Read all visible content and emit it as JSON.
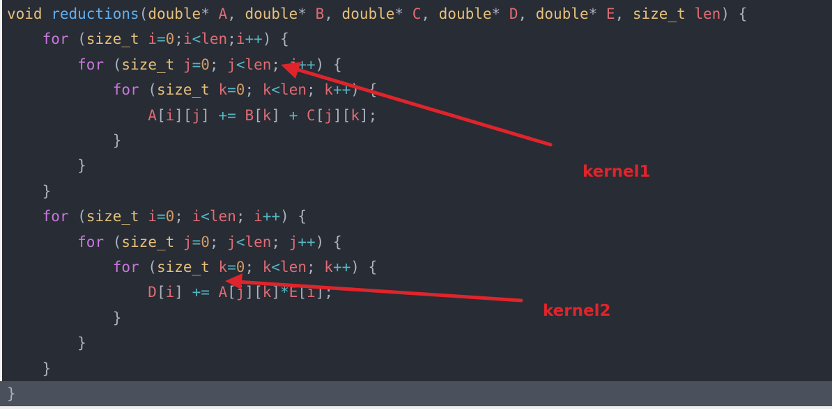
{
  "editor": {
    "lines": [
      [
        [
          "ty",
          "void"
        ],
        [
          "pun",
          " "
        ],
        [
          "fn",
          "reductions"
        ],
        [
          "pun",
          "("
        ],
        [
          "ty",
          "double"
        ],
        [
          "pun",
          "* "
        ],
        [
          "var",
          "A"
        ],
        [
          "pun",
          ", "
        ],
        [
          "ty",
          "double"
        ],
        [
          "pun",
          "* "
        ],
        [
          "var",
          "B"
        ],
        [
          "pun",
          ", "
        ],
        [
          "ty",
          "double"
        ],
        [
          "pun",
          "* "
        ],
        [
          "var",
          "C"
        ],
        [
          "pun",
          ", "
        ],
        [
          "ty",
          "double"
        ],
        [
          "pun",
          "* "
        ],
        [
          "var",
          "D"
        ],
        [
          "pun",
          ", "
        ],
        [
          "ty",
          "double"
        ],
        [
          "pun",
          "* "
        ],
        [
          "var",
          "E"
        ],
        [
          "pun",
          ", "
        ],
        [
          "ty",
          "size_t"
        ],
        [
          "pun",
          " "
        ],
        [
          "var",
          "len"
        ],
        [
          "pun",
          ") {"
        ]
      ],
      [
        [
          "pun",
          "    "
        ],
        [
          "kw",
          "for"
        ],
        [
          "pun",
          " ("
        ],
        [
          "ty",
          "size_t"
        ],
        [
          "pun",
          " "
        ],
        [
          "var",
          "i"
        ],
        [
          "op",
          "="
        ],
        [
          "num",
          "0"
        ],
        [
          "pun",
          ";"
        ],
        [
          "var",
          "i"
        ],
        [
          "op",
          "<"
        ],
        [
          "var",
          "len"
        ],
        [
          "pun",
          ";"
        ],
        [
          "var",
          "i"
        ],
        [
          "op",
          "++"
        ],
        [
          "pun",
          ") {"
        ]
      ],
      [
        [
          "pun",
          "        "
        ],
        [
          "kw",
          "for"
        ],
        [
          "pun",
          " ("
        ],
        [
          "ty",
          "size_t"
        ],
        [
          "pun",
          " "
        ],
        [
          "var",
          "j"
        ],
        [
          "op",
          "="
        ],
        [
          "num",
          "0"
        ],
        [
          "pun",
          "; "
        ],
        [
          "var",
          "j"
        ],
        [
          "op",
          "<"
        ],
        [
          "var",
          "len"
        ],
        [
          "pun",
          "; "
        ],
        [
          "var",
          "j"
        ],
        [
          "op",
          "++"
        ],
        [
          "pun",
          ") {"
        ]
      ],
      [
        [
          "pun",
          "            "
        ],
        [
          "kw",
          "for"
        ],
        [
          "pun",
          " ("
        ],
        [
          "ty",
          "size_t"
        ],
        [
          "pun",
          " "
        ],
        [
          "var",
          "k"
        ],
        [
          "op",
          "="
        ],
        [
          "num",
          "0"
        ],
        [
          "pun",
          "; "
        ],
        [
          "var",
          "k"
        ],
        [
          "op",
          "<"
        ],
        [
          "var",
          "len"
        ],
        [
          "pun",
          "; "
        ],
        [
          "var",
          "k"
        ],
        [
          "op",
          "++"
        ],
        [
          "pun",
          ") {"
        ]
      ],
      [
        [
          "pun",
          "                "
        ],
        [
          "var",
          "A"
        ],
        [
          "pun",
          "["
        ],
        [
          "var",
          "i"
        ],
        [
          "pun",
          "]["
        ],
        [
          "var",
          "j"
        ],
        [
          "pun",
          "] "
        ],
        [
          "op",
          "+="
        ],
        [
          "pun",
          " "
        ],
        [
          "var",
          "B"
        ],
        [
          "pun",
          "["
        ],
        [
          "var",
          "k"
        ],
        [
          "pun",
          "] "
        ],
        [
          "op",
          "+"
        ],
        [
          "pun",
          " "
        ],
        [
          "var",
          "C"
        ],
        [
          "pun",
          "["
        ],
        [
          "var",
          "j"
        ],
        [
          "pun",
          "]["
        ],
        [
          "var",
          "k"
        ],
        [
          "pun",
          "];"
        ]
      ],
      [
        [
          "pun",
          "            }"
        ]
      ],
      [
        [
          "pun",
          "        }"
        ]
      ],
      [
        [
          "pun",
          "    }"
        ]
      ],
      [
        [
          "pun",
          "    "
        ],
        [
          "kw",
          "for"
        ],
        [
          "pun",
          " ("
        ],
        [
          "ty",
          "size_t"
        ],
        [
          "pun",
          " "
        ],
        [
          "var",
          "i"
        ],
        [
          "op",
          "="
        ],
        [
          "num",
          "0"
        ],
        [
          "pun",
          "; "
        ],
        [
          "var",
          "i"
        ],
        [
          "op",
          "<"
        ],
        [
          "var",
          "len"
        ],
        [
          "pun",
          "; "
        ],
        [
          "var",
          "i"
        ],
        [
          "op",
          "++"
        ],
        [
          "pun",
          ") {"
        ]
      ],
      [
        [
          "pun",
          "        "
        ],
        [
          "kw",
          "for"
        ],
        [
          "pun",
          " ("
        ],
        [
          "ty",
          "size_t"
        ],
        [
          "pun",
          " "
        ],
        [
          "var",
          "j"
        ],
        [
          "op",
          "="
        ],
        [
          "num",
          "0"
        ],
        [
          "pun",
          "; "
        ],
        [
          "var",
          "j"
        ],
        [
          "op",
          "<"
        ],
        [
          "var",
          "len"
        ],
        [
          "pun",
          "; "
        ],
        [
          "var",
          "j"
        ],
        [
          "op",
          "++"
        ],
        [
          "pun",
          ") {"
        ]
      ],
      [
        [
          "pun",
          "            "
        ],
        [
          "kw",
          "for"
        ],
        [
          "pun",
          " ("
        ],
        [
          "ty",
          "size_t"
        ],
        [
          "pun",
          " "
        ],
        [
          "var",
          "k"
        ],
        [
          "op",
          "="
        ],
        [
          "num",
          "0"
        ],
        [
          "pun",
          "; "
        ],
        [
          "var",
          "k"
        ],
        [
          "op",
          "<"
        ],
        [
          "var",
          "len"
        ],
        [
          "pun",
          "; "
        ],
        [
          "var",
          "k"
        ],
        [
          "op",
          "++"
        ],
        [
          "pun",
          ") {"
        ]
      ],
      [
        [
          "pun",
          "                "
        ],
        [
          "var",
          "D"
        ],
        [
          "pun",
          "["
        ],
        [
          "var",
          "i"
        ],
        [
          "pun",
          "] "
        ],
        [
          "op",
          "+="
        ],
        [
          "pun",
          " "
        ],
        [
          "var",
          "A"
        ],
        [
          "pun",
          "["
        ],
        [
          "var",
          "j"
        ],
        [
          "pun",
          "]["
        ],
        [
          "var",
          "k"
        ],
        [
          "pun",
          "]"
        ],
        [
          "op",
          "*"
        ],
        [
          "var",
          "E"
        ],
        [
          "pun",
          "["
        ],
        [
          "var",
          "i"
        ],
        [
          "pun",
          "];"
        ]
      ],
      [
        [
          "pun",
          "            }"
        ]
      ],
      [
        [
          "pun",
          "        }"
        ]
      ],
      [
        [
          "pun",
          "    }"
        ]
      ],
      [
        [
          "pun",
          "}"
        ]
      ]
    ]
  },
  "annotations": {
    "kernel1": "kernel1",
    "kernel2": "kernel2"
  },
  "colors": {
    "background": "#282c34",
    "keyword": "#c678dd",
    "type": "#e5c07b",
    "function": "#61afef",
    "variable": "#e06c75",
    "number": "#d19a66",
    "operator": "#56b6c2",
    "punctuation": "#abb2bf",
    "annotation": "#e0242b"
  }
}
